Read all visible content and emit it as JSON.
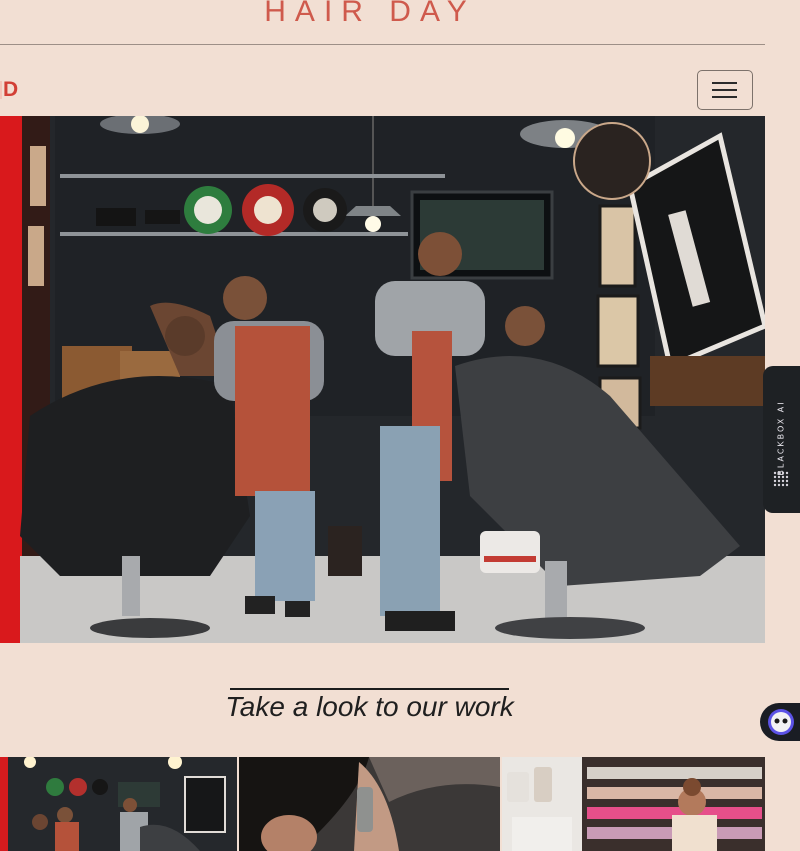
{
  "header": {
    "title": "HAIR DAY"
  },
  "nav": {
    "logo_text": "D",
    "toggle_icon": "hamburger-icon"
  },
  "hero": {
    "image": "barbershop-scene"
  },
  "section": {
    "title": "Take a look to our work"
  },
  "extension": {
    "label": "BLACKBOX AI",
    "bot_icon": "robot-face-icon"
  },
  "gallery": {
    "items": [
      "barbershop-interior",
      "beard-trim-closeup",
      "salon-shelves-stylist"
    ]
  },
  "colors": {
    "background": "#f2dfd3",
    "title": "#cf5a4c",
    "logo": "#d23f35",
    "dark": "#1d1d1d"
  }
}
